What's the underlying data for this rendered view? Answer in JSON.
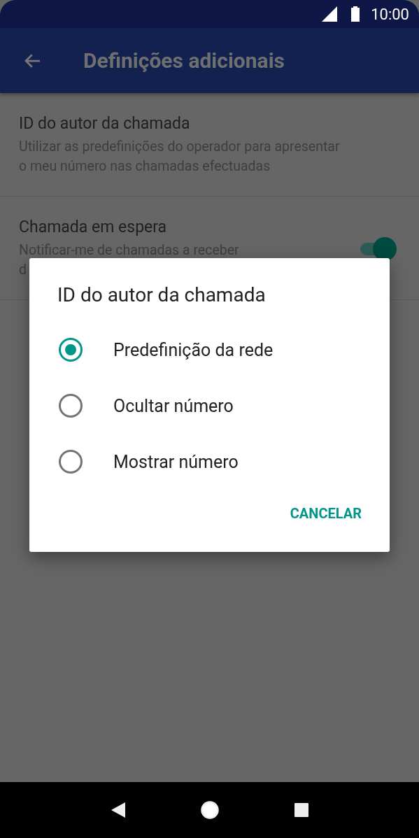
{
  "status_bar": {
    "time": "10:00"
  },
  "app_bar": {
    "title": "Definições adicionais"
  },
  "settings": [
    {
      "kind": "text",
      "title": "ID do autor da chamada",
      "subtitle_lines": [
        "Utilizar as predefinições do operador para apresentar",
        "o meu número nas chamadas efectuadas"
      ]
    },
    {
      "kind": "switch",
      "title": "Chamada em espera",
      "subtitle_lines": [
        "Notificar-me de chamadas a receber",
        "d"
      ],
      "on": true
    }
  ],
  "dialog": {
    "title": "ID do autor da chamada",
    "options": [
      {
        "label": "Predefinição da rede",
        "selected": true
      },
      {
        "label": "Ocultar número",
        "selected": false
      },
      {
        "label": "Mostrar número",
        "selected": false
      }
    ],
    "buttons": [
      "CANCELAR"
    ]
  }
}
